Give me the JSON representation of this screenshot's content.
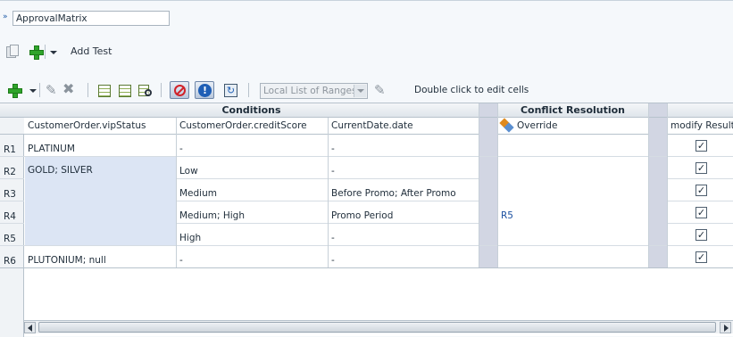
{
  "header": {
    "name_value": "ApprovalMatrix"
  },
  "test_toolbar": {
    "add_test_label": "Add Test"
  },
  "grid_toolbar": {
    "list_select_value": "Local List of Ranges",
    "hint": "Double click to edit cells"
  },
  "grid": {
    "group_headers": {
      "conditions": "Conditions",
      "conflict_resolution": "Conflict Resolution"
    },
    "columns": {
      "vip_status": "CustomerOrder.vipStatus",
      "credit_score": "CustomerOrder.creditScore",
      "current_date": "CurrentDate.date",
      "override": "Override",
      "modify_result": "modify Result"
    },
    "rows": [
      {
        "label": "R1",
        "vip": "PLATINUM",
        "credit": "-",
        "date": "-",
        "override": "",
        "checked": true
      },
      {
        "label": "R2",
        "vip": "GOLD; SILVER",
        "credit": "Low",
        "date": "-",
        "override": "",
        "checked": true
      },
      {
        "label": "R3",
        "vip": "",
        "credit": "Medium",
        "date": "Before Promo; After Promo",
        "override": "",
        "checked": true
      },
      {
        "label": "R4",
        "vip": "",
        "credit": "Medium; High",
        "date": "Promo Period",
        "override": "R5",
        "checked": true
      },
      {
        "label": "R5",
        "vip": "",
        "credit": "High",
        "date": "-",
        "override": "",
        "checked": true
      },
      {
        "label": "R6",
        "vip": "PLUTONIUM; null",
        "credit": "-",
        "date": "-",
        "override": "",
        "checked": true
      }
    ]
  },
  "colors": {
    "merged_cell_bg": "#dce5f4",
    "spacer_column_bg": "#d2d6e3",
    "link": "#1a4fa0",
    "add_green": "#2fa42a"
  }
}
